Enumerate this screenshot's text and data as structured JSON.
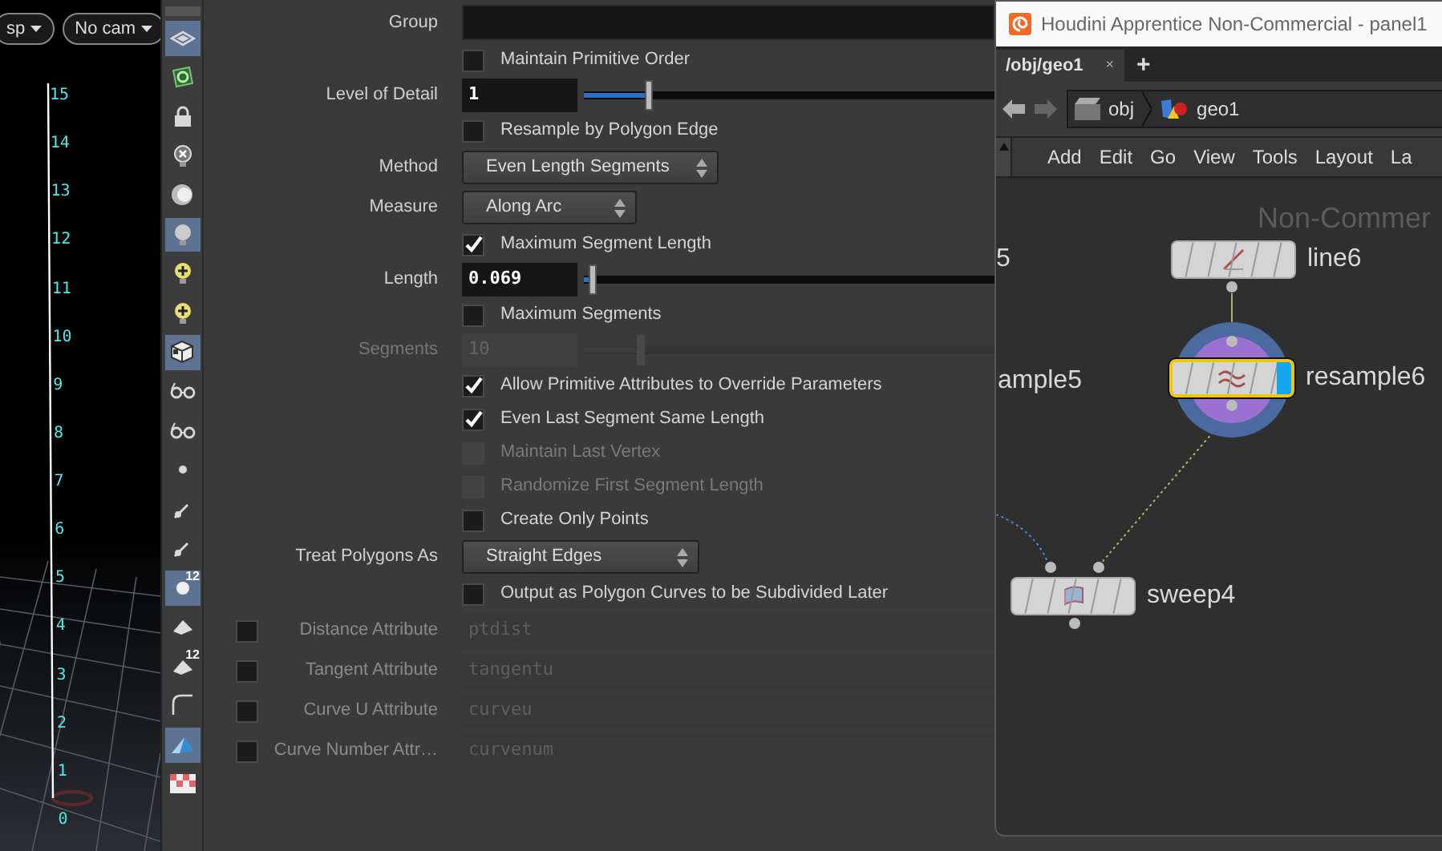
{
  "viewport": {
    "dropdowns": [
      "sp",
      "No cam"
    ],
    "ruler": [
      "15",
      "14",
      "13",
      "12",
      "11",
      "10",
      "9",
      "8",
      "7",
      "6",
      "5",
      "4",
      "3",
      "2",
      "1",
      "0"
    ]
  },
  "toolbar": [
    {
      "selected": true
    },
    {
      "selected": false
    },
    {
      "selected": false
    },
    {
      "selected": false
    },
    {
      "selected": false
    },
    {
      "selected": true
    },
    {
      "selected": false
    },
    {
      "selected": false
    },
    {
      "selected": true
    },
    {
      "selected": false
    },
    {
      "selected": false
    },
    {
      "selected": false
    },
    {
      "selected": false
    },
    {
      "selected": false
    },
    {
      "selected": true,
      "badge": "12"
    },
    {
      "selected": false
    },
    {
      "selected": false,
      "badge": "12"
    },
    {
      "selected": false
    },
    {
      "selected": true
    },
    {
      "selected": false
    }
  ],
  "parameters": [
    {
      "kind": "text",
      "label": "Group"
    },
    {
      "kind": "checkbox",
      "label": "Maintain Primitive Order",
      "checked": false,
      "disabled": false
    },
    {
      "kind": "slider",
      "label": "Level of Detail",
      "value": "1",
      "level": 0.15,
      "disabled": false
    },
    {
      "kind": "checkbox",
      "label": "Resample by Polygon Edge",
      "checked": false,
      "disabled": false
    },
    {
      "kind": "menu",
      "label": "Method",
      "value": "Even Length Segments"
    },
    {
      "kind": "menu",
      "label": "Measure",
      "value": "Along Arc"
    },
    {
      "kind": "checkbox",
      "label": "Maximum Segment Length",
      "checked": true,
      "disabled": false
    },
    {
      "kind": "slider",
      "label": "Length",
      "value": "0.069",
      "level": 0.01,
      "disabled": false
    },
    {
      "kind": "checkbox",
      "label": "Maximum Segments",
      "checked": false,
      "disabled": false
    },
    {
      "kind": "slider",
      "label": "Segments",
      "value": "10",
      "level": 0.13,
      "disabled": true
    },
    {
      "kind": "checkbox",
      "label": "Allow Primitive Attributes to Override Parameters",
      "checked": true,
      "disabled": false
    },
    {
      "kind": "checkbox",
      "label": "Even Last Segment Same Length",
      "checked": true,
      "disabled": false
    },
    {
      "kind": "checkbox",
      "label": "Maintain Last Vertex",
      "checked": false,
      "disabled": true
    },
    {
      "kind": "checkbox",
      "label": "Randomize First Segment Length",
      "checked": false,
      "disabled": true
    },
    {
      "kind": "checkbox",
      "label": "Create Only Points",
      "checked": false,
      "disabled": false
    },
    {
      "kind": "menu",
      "label": "Treat Polygons As",
      "value": "Straight Edges"
    },
    {
      "kind": "checkbox",
      "label": "Output as Polygon Curves to be Subdivided Later",
      "checked": false,
      "disabled": false
    },
    {
      "kind": "attribute",
      "label": "Distance Attribute",
      "value": "ptdist",
      "checked": false
    },
    {
      "kind": "attribute",
      "label": "Tangent Attribute",
      "value": "tangentu",
      "checked": false
    },
    {
      "kind": "attribute",
      "label": "Curve U Attribute",
      "value": "curveu",
      "checked": false
    },
    {
      "kind": "attribute",
      "label": "Curve Number Attr…",
      "value": "curvenum",
      "checked": false
    }
  ],
  "network_window": {
    "title": "Houdini Apprentice Non-Commercial - panel1",
    "tab": {
      "label": "/obj/geo1",
      "close": "×"
    },
    "new_tab": "+",
    "path": [
      "obj",
      "geo1"
    ],
    "menu": [
      "Add",
      "Edit",
      "Go",
      "View",
      "Tools",
      "Layout",
      "La"
    ],
    "watermark": "Non-Commer",
    "partial_labels": [
      "5",
      "ample5"
    ],
    "nodes": [
      {
        "name": "line6",
        "selected": false
      },
      {
        "name": "resample6",
        "selected": true
      },
      {
        "name": "sweep4",
        "selected": false
      }
    ]
  }
}
